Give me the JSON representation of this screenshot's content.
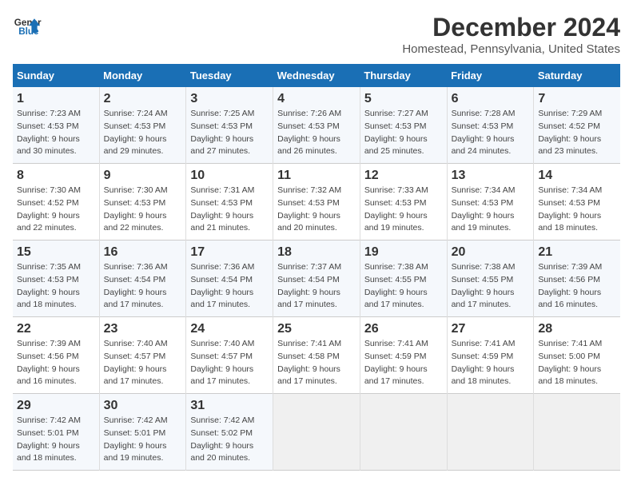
{
  "logo": {
    "line1": "General",
    "line2": "Blue"
  },
  "title": "December 2024",
  "subtitle": "Homestead, Pennsylvania, United States",
  "days_header": [
    "Sunday",
    "Monday",
    "Tuesday",
    "Wednesday",
    "Thursday",
    "Friday",
    "Saturday"
  ],
  "weeks": [
    [
      {
        "day": "1",
        "info": "Sunrise: 7:23 AM\nSunset: 4:53 PM\nDaylight: 9 hours\nand 30 minutes."
      },
      {
        "day": "2",
        "info": "Sunrise: 7:24 AM\nSunset: 4:53 PM\nDaylight: 9 hours\nand 29 minutes."
      },
      {
        "day": "3",
        "info": "Sunrise: 7:25 AM\nSunset: 4:53 PM\nDaylight: 9 hours\nand 27 minutes."
      },
      {
        "day": "4",
        "info": "Sunrise: 7:26 AM\nSunset: 4:53 PM\nDaylight: 9 hours\nand 26 minutes."
      },
      {
        "day": "5",
        "info": "Sunrise: 7:27 AM\nSunset: 4:53 PM\nDaylight: 9 hours\nand 25 minutes."
      },
      {
        "day": "6",
        "info": "Sunrise: 7:28 AM\nSunset: 4:53 PM\nDaylight: 9 hours\nand 24 minutes."
      },
      {
        "day": "7",
        "info": "Sunrise: 7:29 AM\nSunset: 4:52 PM\nDaylight: 9 hours\nand 23 minutes."
      }
    ],
    [
      {
        "day": "8",
        "info": "Sunrise: 7:30 AM\nSunset: 4:52 PM\nDaylight: 9 hours\nand 22 minutes."
      },
      {
        "day": "9",
        "info": "Sunrise: 7:30 AM\nSunset: 4:53 PM\nDaylight: 9 hours\nand 22 minutes."
      },
      {
        "day": "10",
        "info": "Sunrise: 7:31 AM\nSunset: 4:53 PM\nDaylight: 9 hours\nand 21 minutes."
      },
      {
        "day": "11",
        "info": "Sunrise: 7:32 AM\nSunset: 4:53 PM\nDaylight: 9 hours\nand 20 minutes."
      },
      {
        "day": "12",
        "info": "Sunrise: 7:33 AM\nSunset: 4:53 PM\nDaylight: 9 hours\nand 19 minutes."
      },
      {
        "day": "13",
        "info": "Sunrise: 7:34 AM\nSunset: 4:53 PM\nDaylight: 9 hours\nand 19 minutes."
      },
      {
        "day": "14",
        "info": "Sunrise: 7:34 AM\nSunset: 4:53 PM\nDaylight: 9 hours\nand 18 minutes."
      }
    ],
    [
      {
        "day": "15",
        "info": "Sunrise: 7:35 AM\nSunset: 4:53 PM\nDaylight: 9 hours\nand 18 minutes."
      },
      {
        "day": "16",
        "info": "Sunrise: 7:36 AM\nSunset: 4:54 PM\nDaylight: 9 hours\nand 17 minutes."
      },
      {
        "day": "17",
        "info": "Sunrise: 7:36 AM\nSunset: 4:54 PM\nDaylight: 9 hours\nand 17 minutes."
      },
      {
        "day": "18",
        "info": "Sunrise: 7:37 AM\nSunset: 4:54 PM\nDaylight: 9 hours\nand 17 minutes."
      },
      {
        "day": "19",
        "info": "Sunrise: 7:38 AM\nSunset: 4:55 PM\nDaylight: 9 hours\nand 17 minutes."
      },
      {
        "day": "20",
        "info": "Sunrise: 7:38 AM\nSunset: 4:55 PM\nDaylight: 9 hours\nand 17 minutes."
      },
      {
        "day": "21",
        "info": "Sunrise: 7:39 AM\nSunset: 4:56 PM\nDaylight: 9 hours\nand 16 minutes."
      }
    ],
    [
      {
        "day": "22",
        "info": "Sunrise: 7:39 AM\nSunset: 4:56 PM\nDaylight: 9 hours\nand 16 minutes."
      },
      {
        "day": "23",
        "info": "Sunrise: 7:40 AM\nSunset: 4:57 PM\nDaylight: 9 hours\nand 17 minutes."
      },
      {
        "day": "24",
        "info": "Sunrise: 7:40 AM\nSunset: 4:57 PM\nDaylight: 9 hours\nand 17 minutes."
      },
      {
        "day": "25",
        "info": "Sunrise: 7:41 AM\nSunset: 4:58 PM\nDaylight: 9 hours\nand 17 minutes."
      },
      {
        "day": "26",
        "info": "Sunrise: 7:41 AM\nSunset: 4:59 PM\nDaylight: 9 hours\nand 17 minutes."
      },
      {
        "day": "27",
        "info": "Sunrise: 7:41 AM\nSunset: 4:59 PM\nDaylight: 9 hours\nand 18 minutes."
      },
      {
        "day": "28",
        "info": "Sunrise: 7:41 AM\nSunset: 5:00 PM\nDaylight: 9 hours\nand 18 minutes."
      }
    ],
    [
      {
        "day": "29",
        "info": "Sunrise: 7:42 AM\nSunset: 5:01 PM\nDaylight: 9 hours\nand 18 minutes."
      },
      {
        "day": "30",
        "info": "Sunrise: 7:42 AM\nSunset: 5:01 PM\nDaylight: 9 hours\nand 19 minutes."
      },
      {
        "day": "31",
        "info": "Sunrise: 7:42 AM\nSunset: 5:02 PM\nDaylight: 9 hours\nand 20 minutes."
      },
      {
        "day": "",
        "info": ""
      },
      {
        "day": "",
        "info": ""
      },
      {
        "day": "",
        "info": ""
      },
      {
        "day": "",
        "info": ""
      }
    ]
  ]
}
